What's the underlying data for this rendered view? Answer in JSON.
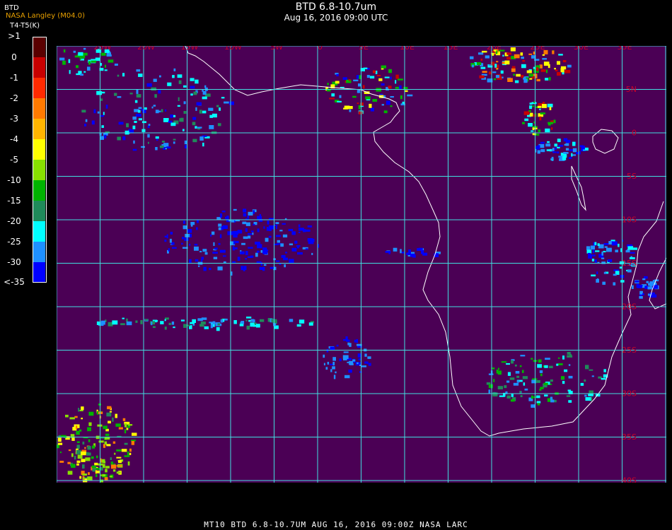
{
  "header": {
    "title": "BTD 6.8-10.7um",
    "subtitle": "Aug 16, 2016 09:00 UTC",
    "credit": "NASA Langley (M04.0)",
    "channel": "BTD",
    "units": "T4-T5(K)"
  },
  "colorbar": {
    "labels": [
      ">1",
      "0",
      "-1",
      "-2",
      "-3",
      "-4",
      "-5",
      "-10",
      "-15",
      "-20",
      "-25",
      "-30",
      "<-35"
    ],
    "colors": [
      "#5a0000",
      "#c80000",
      "#ff2a00",
      "#ff7a00",
      "#ffb400",
      "#ffff00",
      "#88e000",
      "#00b400",
      "#1f8a5a",
      "#00ffff",
      "#1e90ff",
      "#0000ff",
      "#4b0055"
    ]
  },
  "map": {
    "background_color": "#4b0055",
    "grid_color": "#40e0e0",
    "label_color": "#c8002a",
    "longitude_labels": [
      "25W",
      "20W",
      "15W",
      "10W",
      "5W",
      "0",
      "5E",
      "10E",
      "15E",
      "20E",
      "25E",
      "30E",
      "35E"
    ],
    "latitude_labels": [
      "5N",
      "0",
      "5S",
      "10S",
      "15S",
      "20S",
      "25S",
      "30S",
      "35S",
      "40S"
    ]
  },
  "footer": {
    "text": "MT10  BTD 6.8-10.7UM   AUG 16, 2016 09:00Z   NASA LARC"
  }
}
